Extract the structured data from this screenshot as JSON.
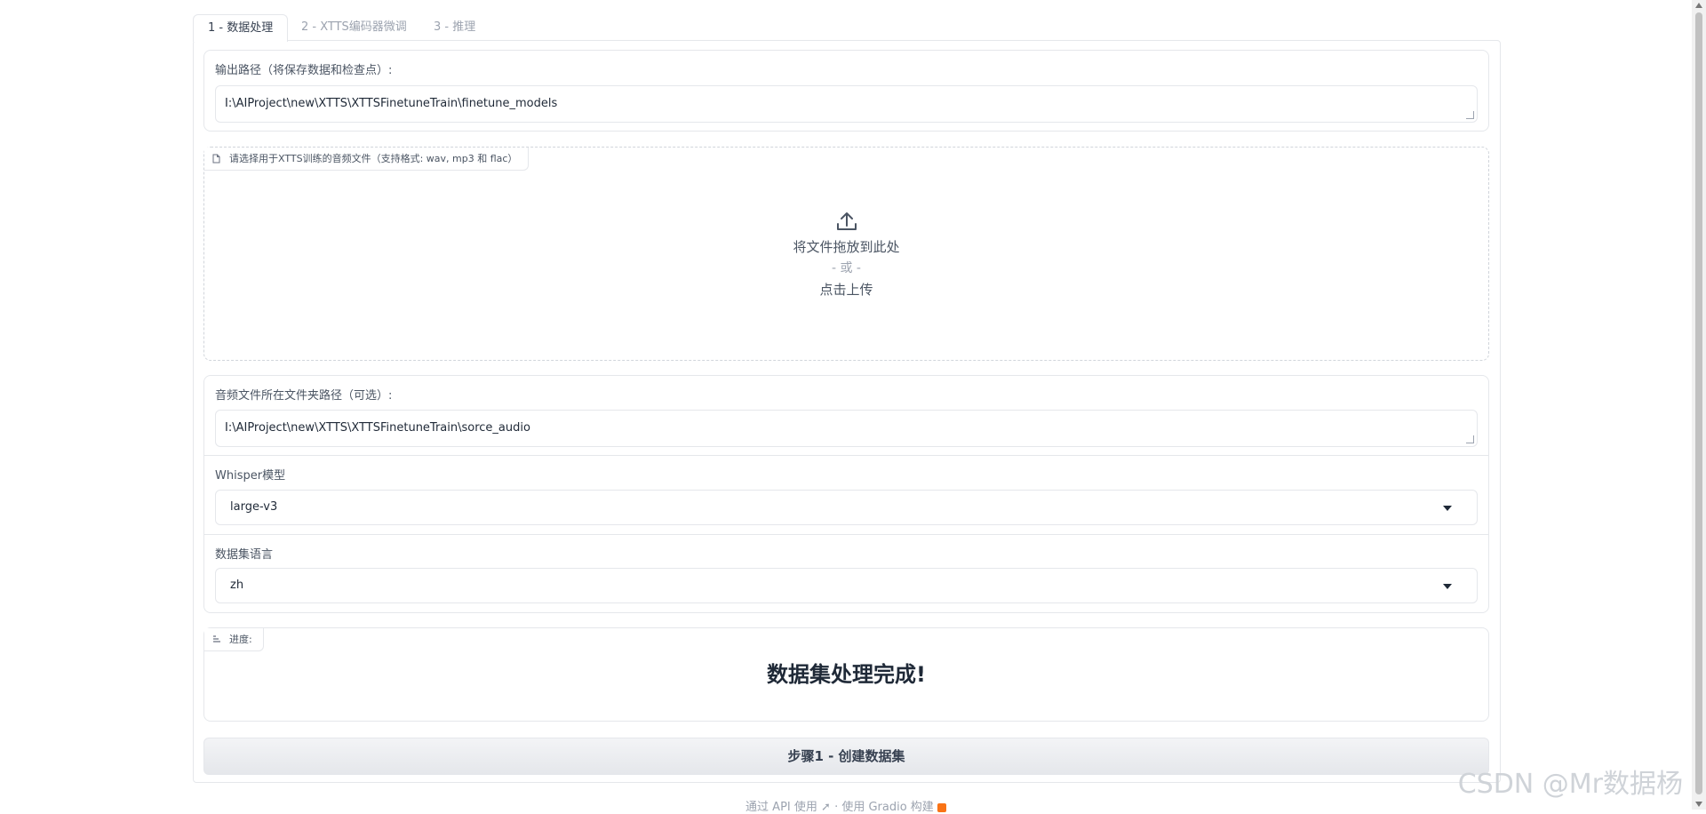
{
  "tabs": [
    {
      "label": "1 - 数据处理",
      "active": true
    },
    {
      "label": "2 - XTTS编码器微调",
      "active": false
    },
    {
      "label": "3 - 推理",
      "active": false
    }
  ],
  "output_path": {
    "label": "输出路径（将保存数据和检查点）:",
    "value": "I:\\AIProject\\new\\XTTS\\XTTSFinetuneTrain\\finetune_models"
  },
  "upload": {
    "label": "请选择用于XTTS训练的音频文件（支持格式: wav, mp3 和 flac）",
    "drop_text": "将文件拖放到此处",
    "or_text": "- 或 -",
    "click_text": "点击上传",
    "icon": "upload-icon"
  },
  "audio_folder": {
    "label": "音频文件所在文件夹路径（可选）:",
    "value": "I:\\AIProject\\new\\XTTS\\XTTSFinetuneTrain\\sorce_audio"
  },
  "whisper_model": {
    "label": "Whisper模型",
    "value": "large-v3"
  },
  "dataset_language": {
    "label": "数据集语言",
    "value": "zh"
  },
  "progress": {
    "label": "进度:",
    "text": "数据集处理完成!"
  },
  "run_button": {
    "label": "步骤1 - 创建数据集"
  },
  "footer": {
    "api_text": "通过 API 使用",
    "separator": "·",
    "built_text": "使用 Gradio 构建"
  },
  "watermark": "CSDN @Mr数据杨"
}
